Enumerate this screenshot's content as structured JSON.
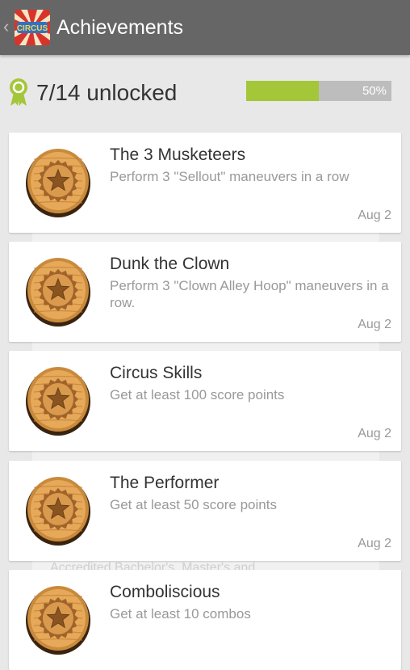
{
  "action_bar": {
    "title": "Achievements",
    "up_icon": "chevron-left-icon",
    "app_icon": "circus-app-icon",
    "app_icon_text": "CIRCUS"
  },
  "summary": {
    "icon": "award-ribbon-icon",
    "unlocked_text": "7/14 unlocked",
    "progress_label": "50%",
    "progress_fraction": 0.5,
    "progress_color": "#a4c639"
  },
  "background_text": "Accredited Bachelor's, Master's and",
  "achievements": [
    {
      "title": "The 3 Musketeers",
      "description": "Perform 3 \"Sellout\" maneuvers in a row",
      "date": "Aug 2",
      "icon": "star-badge-icon"
    },
    {
      "title": "Dunk the Clown",
      "description": "Perform 3 \"Clown Alley Hoop\" maneuvers in a row.",
      "date": "Aug 2",
      "icon": "star-badge-icon"
    },
    {
      "title": "Circus Skills",
      "description": "Get at least 100 score points",
      "date": "Aug 2",
      "icon": "star-badge-icon"
    },
    {
      "title": "The Performer",
      "description": "Get at least 50 score points",
      "date": "Aug 2",
      "icon": "star-badge-icon"
    },
    {
      "title": "Comboliscious",
      "description": "Get at least 10 combos",
      "date": "",
      "icon": "star-badge-icon"
    }
  ]
}
